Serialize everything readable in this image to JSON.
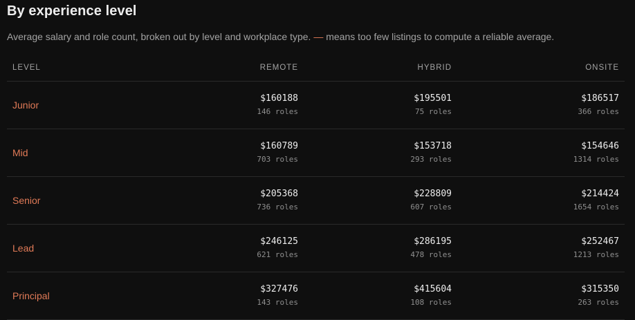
{
  "header": {
    "title": "By experience level",
    "subtitle_before": "Average salary and role count, broken out by level and workplace type.",
    "subtitle_dash": "—",
    "subtitle_after": "means too few listings to compute a reliable average."
  },
  "colors": {
    "background": "#0f0f0f",
    "accent": "#e07a57",
    "text": "#ededed",
    "muted": "#a3a3a3"
  },
  "table": {
    "columns": {
      "level": "LEVEL",
      "remote": "REMOTE",
      "hybrid": "HYBRID",
      "onsite": "ONSITE"
    },
    "rows": [
      {
        "level": "Junior",
        "remote": {
          "salary": "$160188",
          "roles": "146 roles"
        },
        "hybrid": {
          "salary": "$195501",
          "roles": "75 roles"
        },
        "onsite": {
          "salary": "$186517",
          "roles": "366 roles"
        }
      },
      {
        "level": "Mid",
        "remote": {
          "salary": "$160789",
          "roles": "703 roles"
        },
        "hybrid": {
          "salary": "$153718",
          "roles": "293 roles"
        },
        "onsite": {
          "salary": "$154646",
          "roles": "1314 roles"
        }
      },
      {
        "level": "Senior",
        "remote": {
          "salary": "$205368",
          "roles": "736 roles"
        },
        "hybrid": {
          "salary": "$228809",
          "roles": "607 roles"
        },
        "onsite": {
          "salary": "$214424",
          "roles": "1654 roles"
        }
      },
      {
        "level": "Lead",
        "remote": {
          "salary": "$246125",
          "roles": "621 roles"
        },
        "hybrid": {
          "salary": "$286195",
          "roles": "478 roles"
        },
        "onsite": {
          "salary": "$252467",
          "roles": "1213 roles"
        }
      },
      {
        "level": "Principal",
        "remote": {
          "salary": "$327476",
          "roles": "143 roles"
        },
        "hybrid": {
          "salary": "$415604",
          "roles": "108 roles"
        },
        "onsite": {
          "salary": "$315350",
          "roles": "263 roles"
        }
      }
    ]
  }
}
